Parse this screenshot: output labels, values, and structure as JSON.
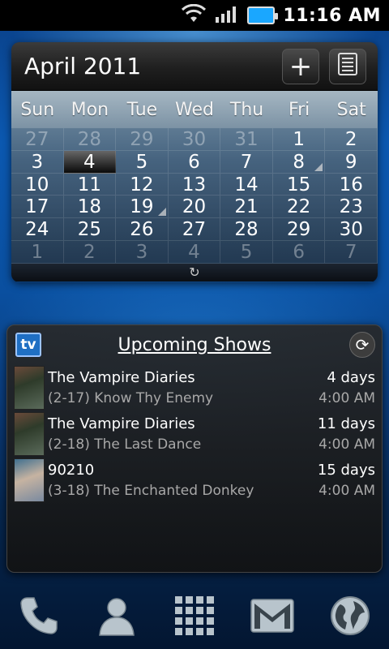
{
  "status_bar": {
    "time": "11:16 AM"
  },
  "calendar": {
    "month_title": "April 2011",
    "add_label": "+",
    "weekdays": [
      "Sun",
      "Mon",
      "Tue",
      "Wed",
      "Thu",
      "Fri",
      "Sat"
    ],
    "weeks": [
      [
        "27",
        "28",
        "29",
        "30",
        "31",
        "1",
        "2"
      ],
      [
        "3",
        "4",
        "5",
        "6",
        "7",
        "8",
        "9"
      ],
      [
        "10",
        "11",
        "12",
        "13",
        "14",
        "15",
        "16"
      ],
      [
        "17",
        "18",
        "19",
        "20",
        "21",
        "22",
        "23"
      ],
      [
        "24",
        "25",
        "26",
        "27",
        "28",
        "29",
        "30"
      ],
      [
        "1",
        "2",
        "3",
        "4",
        "5",
        "6",
        "7"
      ]
    ],
    "sync_icon": "↻"
  },
  "shows": {
    "logo": "tv",
    "title": "Upcoming Shows",
    "items": [
      {
        "name": "The Vampire Diaries",
        "episode": "(2-17) Know Thy Enemy",
        "days": "4 days",
        "time": "4:00 AM"
      },
      {
        "name": "The Vampire Diaries",
        "episode": "(2-18) The Last Dance",
        "days": "11 days",
        "time": "4:00 AM"
      },
      {
        "name": "90210",
        "episode": "(3-18) The Enchanted Donkey",
        "days": "15 days",
        "time": "4:00 AM"
      }
    ]
  },
  "colors": {
    "battery": "#1aa7ff",
    "tv_logo": "#1f6fc3"
  },
  "dock": {
    "icons": [
      "phone-icon",
      "contacts-icon",
      "app-drawer-icon",
      "mail-icon",
      "browser-icon"
    ]
  }
}
